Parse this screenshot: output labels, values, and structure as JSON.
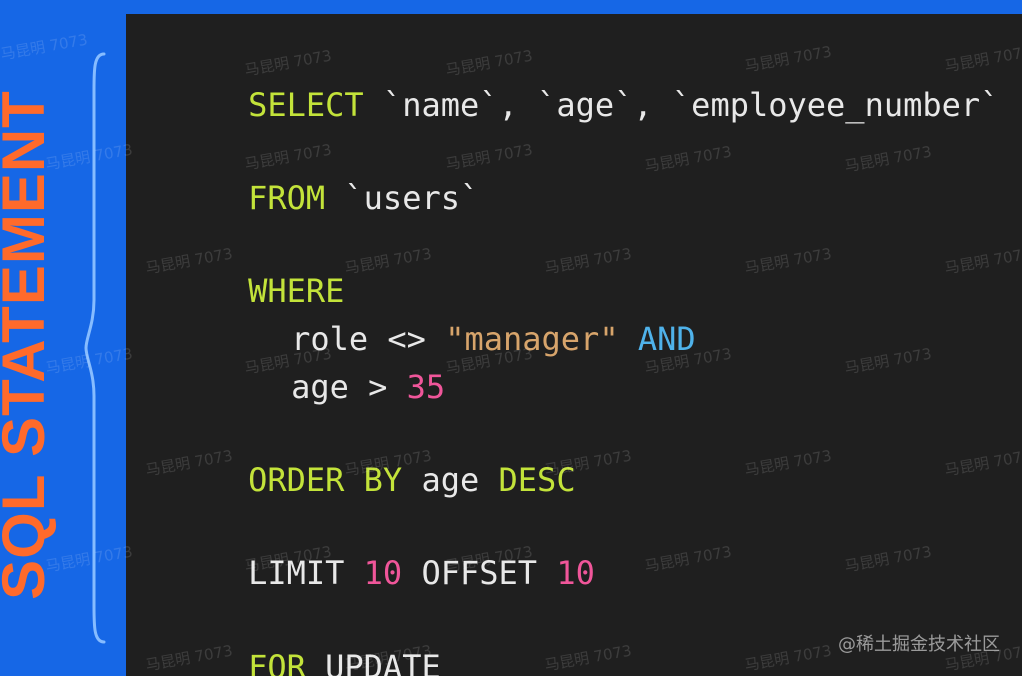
{
  "side_title": "SQL STATEMENT",
  "code": {
    "line1": {
      "kw_select": "SELECT",
      "col1": " `name`,",
      "col2": " `age`,",
      "col3": " `employee_number`"
    },
    "line2": {
      "kw_from": "FROM",
      "table": " `users`"
    },
    "line3": {
      "kw_where": "WHERE"
    },
    "line4": {
      "left": "role <> ",
      "string": "\"manager\"",
      "kw_and": " AND"
    },
    "line5": {
      "left": "age > ",
      "number": "35"
    },
    "line6": {
      "kw_order": "ORDER BY",
      "column": " age",
      "kw_desc": " DESC"
    },
    "line7": {
      "kw_limit": "LIMIT",
      "limit_value": " 10",
      "kw_offset": " OFFSET",
      "offset_value": " 10"
    },
    "line8": {
      "kw_for": "FOR",
      "kw_update": " UPDATE"
    }
  },
  "watermark_text": "马昆明 7073",
  "brand_text": "@稀土掘金技术社区",
  "colors": {
    "background": "#1667e6",
    "panel": "#1f1f1f",
    "title": "#ff6a2b",
    "keyword": "#c3e33a",
    "string": "#d7a46b",
    "number": "#f0569a",
    "operator_keyword": "#4fb2ea",
    "plain_text": "#e8e8e8"
  }
}
